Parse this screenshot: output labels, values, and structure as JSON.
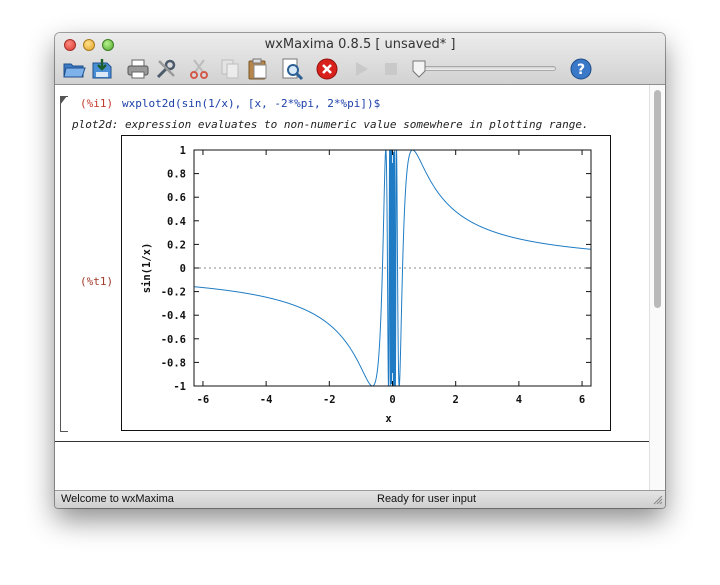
{
  "window": {
    "title": "wxMaxima 0.8.5 [ unsaved* ]"
  },
  "toolbar": {
    "icons": [
      "open-icon",
      "save-icon",
      "print-icon",
      "preferences-icon",
      "cut-icon",
      "copy-icon",
      "paste-icon",
      "find-icon",
      "interrupt-icon",
      "play-icon",
      "stop-icon",
      "animation-slider",
      "help-icon"
    ]
  },
  "cell": {
    "input_prompt": "(%i1)",
    "input_code": "wxplot2d(sin(1/x), [x, -2*%pi, 2*%pi])$",
    "message": "plot2d: expression evaluates to non-numeric value somewhere in plotting range.",
    "output_prompt": "(%t1)"
  },
  "chart_data": {
    "type": "line",
    "title": "",
    "xlabel": "x",
    "ylabel": "sin(1/x)",
    "xlim": [
      -6.2832,
      6.2832
    ],
    "ylim": [
      -1,
      1
    ],
    "xticks": [
      "-6",
      "-4",
      "-2",
      "0",
      "2",
      "4",
      "6"
    ],
    "yticks": [
      "1",
      "0.8",
      "0.6",
      "0.4",
      "0.2",
      "0",
      "-0.2",
      "-0.4",
      "-0.6",
      "-0.8",
      "-1"
    ],
    "zero_line": true,
    "series": [
      {
        "function": "sin(1/x)",
        "color": "#1f7cc4"
      }
    ]
  },
  "status": {
    "left": "Welcome to wxMaxima",
    "center": "Ready for user input"
  },
  "colors": {
    "prompt": "#c0392b",
    "code": "#1a3fa8",
    "plot_line": "#1f7cc4"
  }
}
